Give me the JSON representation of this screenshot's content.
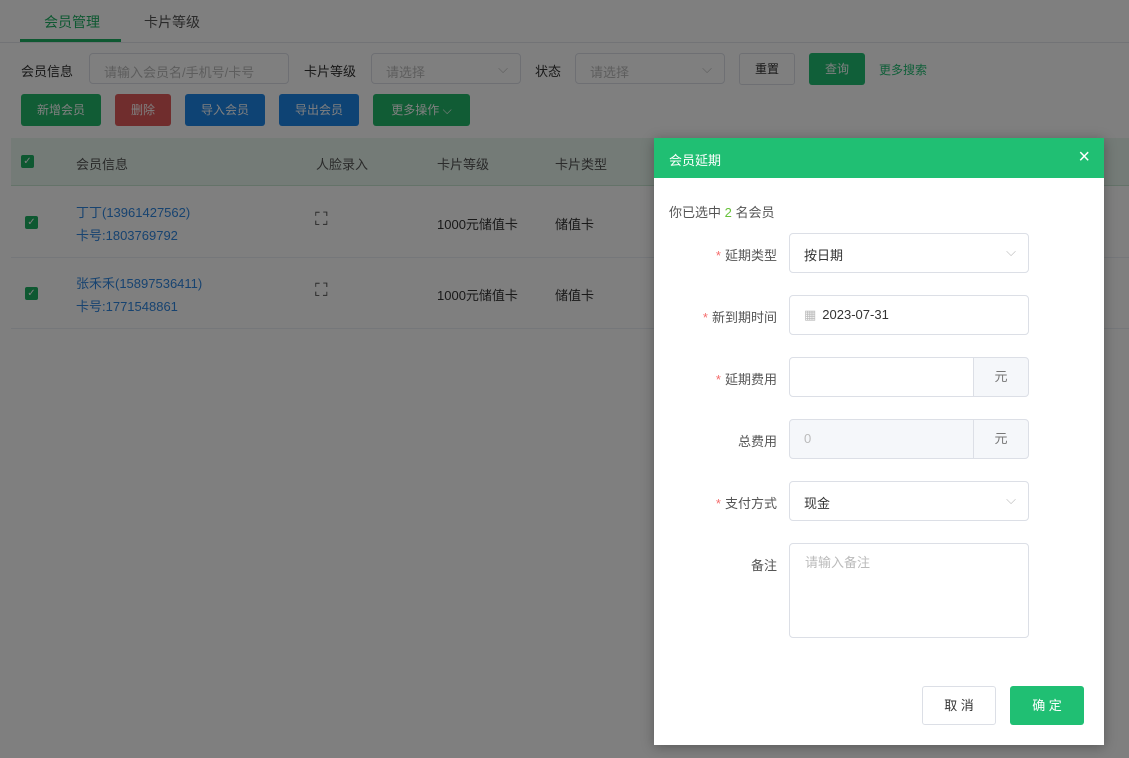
{
  "tabs": [
    "会员管理",
    "卡片等级"
  ],
  "filters": {
    "member_label": "会员信息",
    "member_placeholder": "请输入会员名/手机号/卡号",
    "level_label": "卡片等级",
    "level_placeholder": "请选择",
    "status_label": "状态",
    "status_placeholder": "请选择",
    "reset": "重置",
    "query": "查询",
    "more_search": "更多搜索"
  },
  "toolbar": {
    "add": "新增会员",
    "delete": "删除",
    "import": "导入会员",
    "export": "导出会员",
    "more": "更多操作"
  },
  "table": {
    "headers": [
      "会员信息",
      "人脸录入",
      "卡片等级",
      "卡片类型"
    ],
    "rows": [
      {
        "name": "丁丁(13961427562)",
        "card": "卡号:1803769792",
        "level": "1000元储值卡",
        "type": "储值卡"
      },
      {
        "name": "张禾禾(15897536411)",
        "card": "卡号:1771548861",
        "level": "1000元储值卡",
        "type": "储值卡"
      }
    ]
  },
  "dialog": {
    "title": "会员延期",
    "selected_prefix": "你已选中",
    "selected_count": "2",
    "selected_suffix": "名会员",
    "extend_type_label": "延期类型",
    "extend_type_value": "按日期",
    "new_expire_label": "新到期时间",
    "new_expire_value": "2023-07-31",
    "fee_label": "延期费用",
    "fee_unit": "元",
    "total_label": "总费用",
    "total_value": "0",
    "total_unit": "元",
    "pay_label": "支付方式",
    "pay_value": "现金",
    "remark_label": "备注",
    "remark_placeholder": "请输入备注",
    "cancel": "取 消",
    "confirm": "确 定"
  },
  "colors": {
    "accent": "#20bf73",
    "danger": "#e05a5a",
    "blue": "#1c86e8"
  }
}
